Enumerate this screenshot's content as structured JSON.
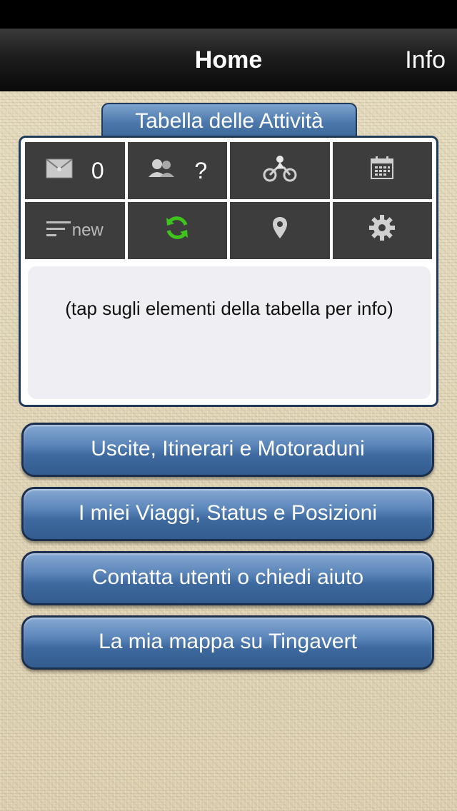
{
  "nav": {
    "title": "Home",
    "info_label": "Info"
  },
  "panel": {
    "tab_label": "Tabella delle Attività",
    "cells": {
      "messages": {
        "icon": "mail-icon",
        "count": "0"
      },
      "users": {
        "icon": "users-icon",
        "count": "?"
      },
      "motorbike": {
        "icon": "motorbike-icon"
      },
      "calendar": {
        "icon": "calendar-icon"
      },
      "news": {
        "icon": "list-icon",
        "label": "new"
      },
      "refresh": {
        "icon": "refresh-icon",
        "color": "#3ec41d"
      },
      "location": {
        "icon": "location-pin-icon"
      },
      "settings": {
        "icon": "gear-icon"
      }
    },
    "info_text": "(tap sugli elementi della tabella per info)"
  },
  "menu": [
    {
      "label": "Uscite, Itinerari e Motoraduni"
    },
    {
      "label": "I miei Viaggi, Status e Posizioni"
    },
    {
      "label": "Contatta utenti o chiedi aiuto"
    },
    {
      "label": "La mia mappa su Tingavert"
    }
  ],
  "colors": {
    "nav_bg": "#111111",
    "button_blue": "#4b77aa",
    "panel_border": "#1f3a5c",
    "cell_bg": "#3d3d3d",
    "refresh_green": "#3ec41d"
  }
}
